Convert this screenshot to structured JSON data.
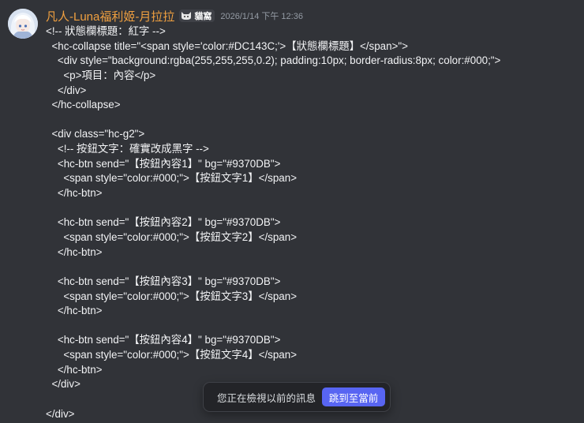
{
  "message": {
    "username": "凡人-Luna福利姬-月拉拉",
    "role_tag": "貓窩",
    "role_tag_icon": "cat-face-icon",
    "timestamp": "2026/1/14 下午 12:36",
    "avatar_icon": "user-avatar-icon",
    "lines": [
      "<!-- 狀態欄標題：紅字 -->",
      "  <hc-collapse title=\"<span style='color:#DC143C;'>【狀態欄標題】</span>\">",
      "    <div style=\"background:rgba(255,255,255,0.2); padding:10px; border-radius:8px; color:#000;\">",
      "      <p>項目：內容</p>",
      "    </div>",
      "  </hc-collapse>",
      "",
      "  <div class=\"hc-g2\">",
      "    <!-- 按鈕文字：確實改成黑字 -->",
      "    <hc-btn send=\"【按鈕內容1】\" bg=\"#9370DB\">",
      "      <span style=\"color:#000;\">【按鈕文字1】</span>",
      "    </hc-btn>",
      "",
      "    <hc-btn send=\"【按鈕內容2】\" bg=\"#9370DB\">",
      "      <span style=\"color:#000;\">【按鈕文字2】</span>",
      "    </hc-btn>",
      "",
      "    <hc-btn send=\"【按鈕內容3】\" bg=\"#9370DB\">",
      "      <span style=\"color:#000;\">【按鈕文字3】</span>",
      "    </hc-btn>",
      "",
      "    <hc-btn send=\"【按鈕內容4】\" bg=\"#9370DB\">",
      "      <span style=\"color:#000;\">【按鈕文字4】</span>",
      "    </hc-btn>",
      "  </div>",
      "",
      "</div>"
    ]
  },
  "jump_bar": {
    "text": "您正在檢視以前的訊息",
    "button_label": "跳到至當前"
  },
  "colors": {
    "background": "#313338",
    "username": "#f0a040",
    "timestamp": "#949ba4",
    "message_text": "#f2f3f5",
    "jump_bar_bg": "#232428",
    "jump_button_bg": "#5865f2"
  }
}
